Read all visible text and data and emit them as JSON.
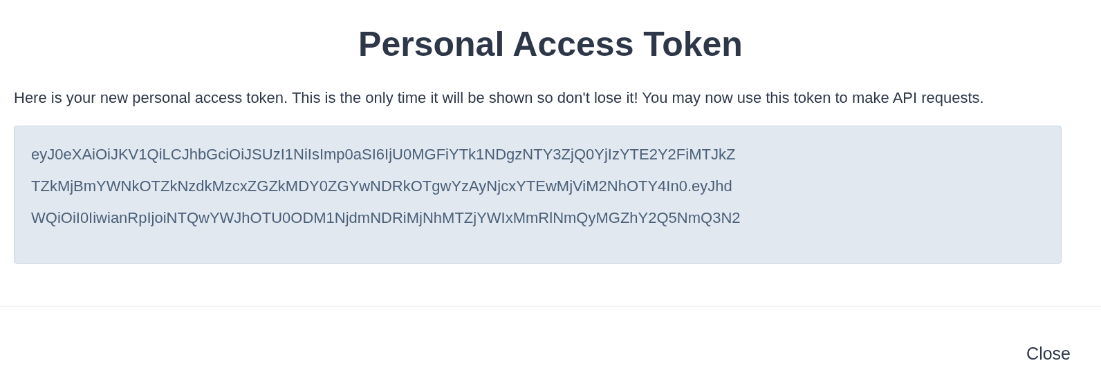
{
  "modal": {
    "title": "Personal Access Token",
    "message": "Here is your new personal access token. This is the only time it will be shown so don't lose it! You may now use this token to make API requests.",
    "token_lines": [
      "eyJ0eXAiOiJKV1QiLCJhbGciOiJSUzI1NiIsImp0aSI6IjU0MGFiYTk1NDgzNTY3ZjQ0YjIzYTE2Y2FiMTJkZ",
      "TZkMjBmYWNkOTZkNzdkMzcxZGZkMDY0ZGYwNDRkOTgwYzAyNjcxYTEwMjViM2NhOTY4In0.eyJhd",
      "WQiOiI0IiwianRpIjoiNTQwYWJhOTU0ODM1NjdmNDRiMjNhMTZjYWIxMmRlNmQyMGZhY2Q5NmQ3N2"
    ],
    "close_button": "Close"
  }
}
